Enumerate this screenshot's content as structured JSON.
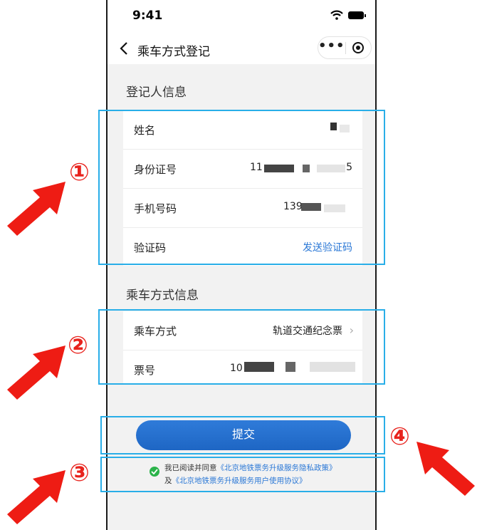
{
  "status": {
    "time": "9:41"
  },
  "nav": {
    "title": "乘车方式登记"
  },
  "registrant": {
    "section_title": "登记人信息",
    "name_label": "姓名",
    "id_label": "身份证号",
    "id_value_prefix": "11",
    "id_value_suffix": "5",
    "phone_label": "手机号码",
    "phone_value_prefix": "139",
    "code_label": "验证码",
    "send_code": "发送验证码"
  },
  "ride": {
    "section_title": "乘车方式信息",
    "mode_label": "乘车方式",
    "mode_value": "轨道交通纪念票",
    "ticket_label": "票号",
    "ticket_value_prefix": "10"
  },
  "submit_label": "提交",
  "agreement": {
    "prefix": "我已阅读并同意",
    "privacy_link": "《北京地铁票务升级服务隐私政策》",
    "middle": "及",
    "terms_link": "《北京地铁票务升级服务用户使用协议》"
  },
  "annotations": [
    "①",
    "②",
    "③",
    "④"
  ],
  "colors": {
    "accent": "#2b78d6",
    "annotation_box": "#29aee8",
    "annotation_red": "#e8231d",
    "check_green": "#2bb34a"
  }
}
